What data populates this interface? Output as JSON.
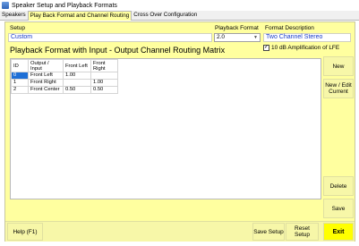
{
  "window": {
    "title": "Speaker Setup and Playback Formats",
    "icon": "app-icon"
  },
  "tabs": [
    {
      "label": "Speakers",
      "active": false
    },
    {
      "label": "Play Back Format and Channel Routing",
      "active": true
    },
    {
      "label": "Cross Over Configuration",
      "active": false
    }
  ],
  "setup": {
    "label": "Setup",
    "value": "Custom"
  },
  "playback": {
    "label": "Playback Format",
    "value": "2.0"
  },
  "format": {
    "label": "Format Description",
    "value": "Two Channel Stereo"
  },
  "lfe": {
    "label": "10 dB Amplification of LFE",
    "checked": true
  },
  "matrix": {
    "title": "Playback Format with Input - Output Channel Routing Matrix",
    "columns": [
      "ID",
      "Output / Input",
      "Front Left",
      "Front Right"
    ],
    "rows": [
      [
        "0",
        "Front Left",
        "1.00",
        ""
      ],
      [
        "1",
        "Front Right",
        "",
        "1.00"
      ],
      [
        "2",
        "Front Center",
        "0.50",
        "0.50"
      ]
    ],
    "selected_row": 0
  },
  "side_buttons": {
    "new": "New",
    "new_edit": "New / Edit Current",
    "delete": "Delete",
    "save": "Save"
  },
  "bottom_buttons": {
    "help": "Help (F1)",
    "save_setup": "Save Setup",
    "reset_setup": "Reset Setup",
    "exit": "Exit"
  },
  "colors": {
    "panel": "#ffff9f",
    "value_text": "#1a3cc8",
    "selection": "#1e6fd6",
    "exit": "#ffff00"
  }
}
